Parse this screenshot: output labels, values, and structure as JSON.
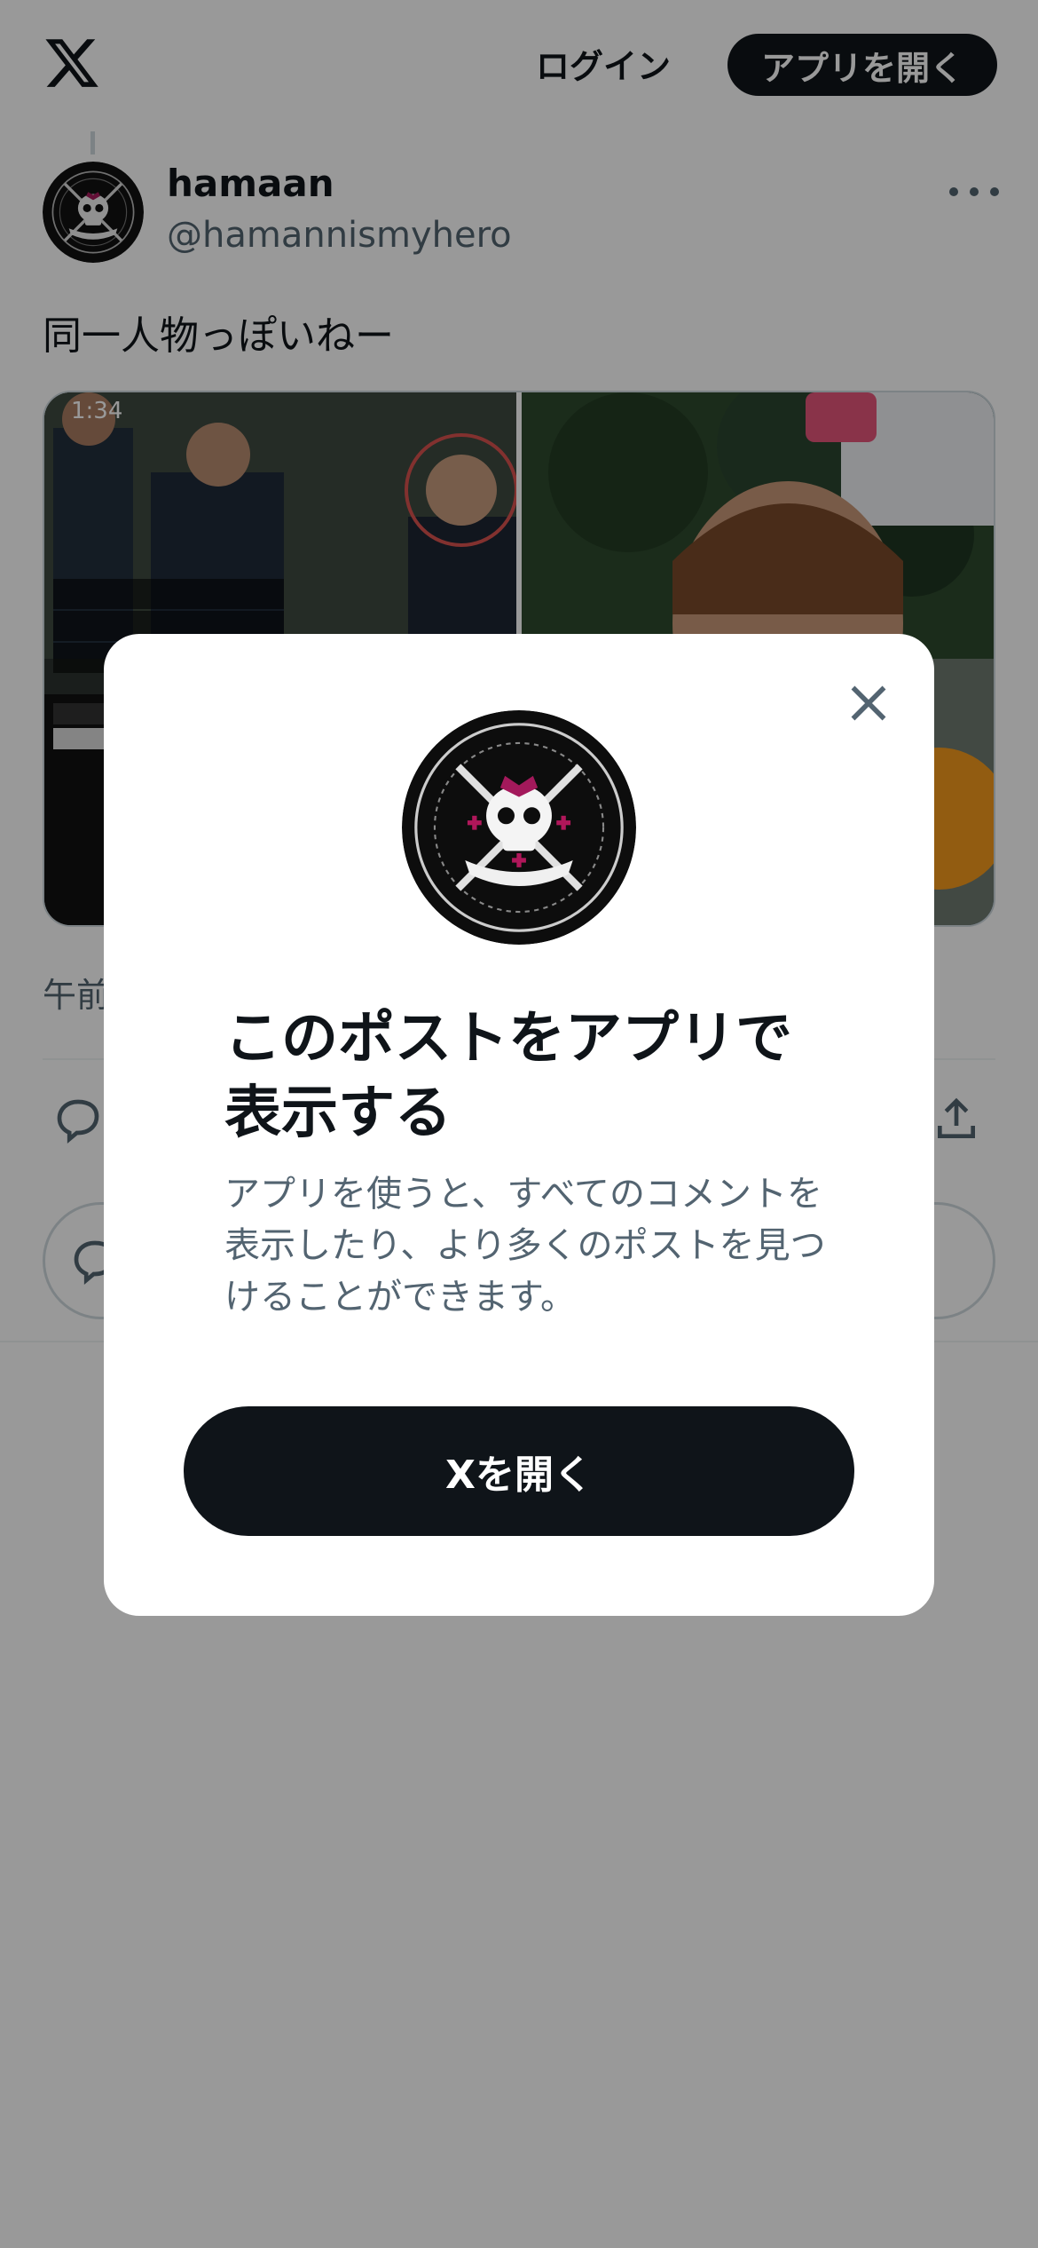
{
  "header": {
    "login_label": "ログイン",
    "open_app_label": "アプリを開く"
  },
  "post": {
    "display_name": "hamaan",
    "handle": "@hamannismyhero",
    "text": "同一人物っぽいねー",
    "media": {
      "video_time": "1:34"
    },
    "timestamp": "午前"
  },
  "modal": {
    "title": "このポストをアプリで表示する",
    "description": "アプリを使うと、すべてのコメントを表示したり、より多くのポストを見つけることができます。",
    "cta_label": "Xを開く"
  },
  "colors": {
    "text_primary": "#0f1419",
    "text_secondary": "#536471",
    "button_dark": "#0f1419",
    "overlay": "rgba(0,0,0,0.4)"
  },
  "icons": [
    "x-logo-icon",
    "more-icon",
    "reply-icon",
    "share-icon",
    "close-icon"
  ]
}
